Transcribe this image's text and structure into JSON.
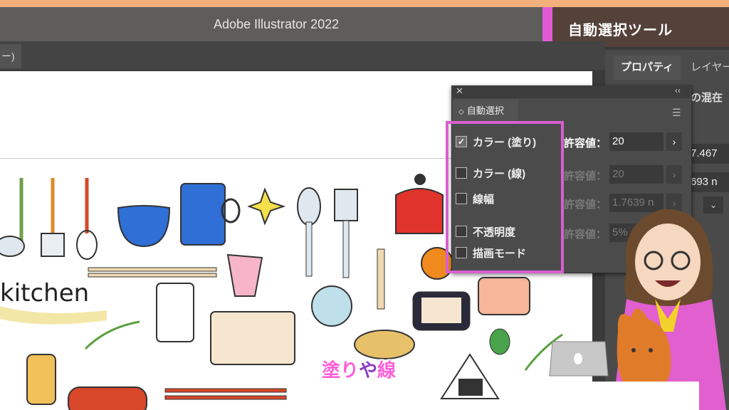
{
  "window": {
    "title": "Adobe Illustrator 2022"
  },
  "banner": {
    "tool_name": "自動選択ツール"
  },
  "document_tab": {
    "label": "ー)"
  },
  "right_panel": {
    "tabs": [
      "プロパティ",
      "レイヤー"
    ],
    "section_snippet": "の混在",
    "x_value": "7.467",
    "y_value": "693 n"
  },
  "magic_wand_panel": {
    "tab_label": "自動選択",
    "options": [
      {
        "label": "カラー (塗り)",
        "checked": true,
        "tolerance_label": "許容値：",
        "tolerance_value": "20",
        "enabled": true
      },
      {
        "label": "カラー (線)",
        "checked": false,
        "tolerance_label": "許容値：",
        "tolerance_value": "20",
        "enabled": false
      },
      {
        "label": "線幅",
        "checked": false,
        "tolerance_label": "許容値：",
        "tolerance_value": "1.7639 n",
        "enabled": false
      },
      {
        "label": "不透明度",
        "checked": false,
        "tolerance_label": "許容値：",
        "tolerance_value": "5%",
        "enabled": false
      },
      {
        "label": "描画モード",
        "checked": false
      }
    ]
  },
  "artboard": {
    "text": "kitchen"
  },
  "caption": {
    "part1": "塗り",
    "part2": "や",
    "part3": "線"
  },
  "colors": {
    "accent": "#e05bd2",
    "highlight": "#d85fd0",
    "banner_bg": "#54423a",
    "caption": "#ff5fd7"
  }
}
